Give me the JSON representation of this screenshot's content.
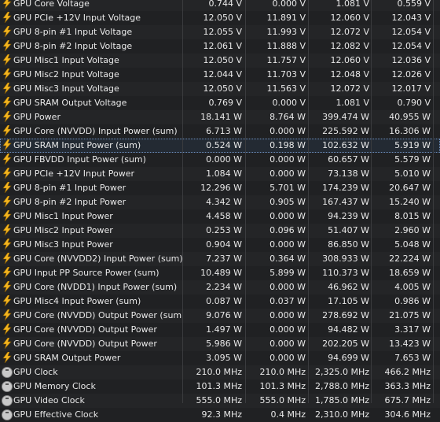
{
  "rows": [
    {
      "icon": "bolt-icon",
      "name": "GPU Core Voltage",
      "current": "0.744 V",
      "min": "0.000 V",
      "max": "1.081 V",
      "avg": "0.559 V"
    },
    {
      "icon": "bolt-icon",
      "name": "GPU PCIe +12V Input Voltage",
      "current": "12.050 V",
      "min": "11.891 V",
      "max": "12.060 V",
      "avg": "12.043 V"
    },
    {
      "icon": "bolt-icon",
      "name": "GPU 8-pin #1 Input Voltage",
      "current": "12.055 V",
      "min": "11.993 V",
      "max": "12.072 V",
      "avg": "12.054 V"
    },
    {
      "icon": "bolt-icon",
      "name": "GPU 8-pin #2 Input Voltage",
      "current": "12.061 V",
      "min": "11.888 V",
      "max": "12.082 V",
      "avg": "12.054 V"
    },
    {
      "icon": "bolt-icon",
      "name": "GPU Misc1 Input Voltage",
      "current": "12.050 V",
      "min": "11.757 V",
      "max": "12.060 V",
      "avg": "12.036 V"
    },
    {
      "icon": "bolt-icon",
      "name": "GPU Misc2 Input Voltage",
      "current": "12.044 V",
      "min": "11.703 V",
      "max": "12.048 V",
      "avg": "12.026 V"
    },
    {
      "icon": "bolt-icon",
      "name": "GPU Misc3 Input Voltage",
      "current": "12.050 V",
      "min": "11.563 V",
      "max": "12.072 V",
      "avg": "12.017 V"
    },
    {
      "icon": "bolt-icon",
      "name": "GPU SRAM Output Voltage",
      "current": "0.769 V",
      "min": "0.000 V",
      "max": "1.081 V",
      "avg": "0.790 V"
    },
    {
      "icon": "bolt-icon",
      "name": "GPU Power",
      "current": "18.141 W",
      "min": "8.764 W",
      "max": "399.474 W",
      "avg": "40.955 W"
    },
    {
      "icon": "bolt-icon",
      "name": "GPU Core (NVVDD) Input Power (sum)",
      "current": "6.713 W",
      "min": "0.000 W",
      "max": "225.592 W",
      "avg": "16.306 W"
    },
    {
      "icon": "bolt-icon",
      "name": "GPU SRAM Input Power (sum)",
      "current": "0.524 W",
      "min": "0.198 W",
      "max": "102.632 W",
      "avg": "5.919 W",
      "selected": true
    },
    {
      "icon": "bolt-icon",
      "name": "GPU FBVDD Input Power (sum)",
      "current": "0.000 W",
      "min": "0.000 W",
      "max": "60.657 W",
      "avg": "5.579 W"
    },
    {
      "icon": "bolt-icon",
      "name": "GPU PCIe +12V Input Power",
      "current": "1.084 W",
      "min": "0.000 W",
      "max": "73.138 W",
      "avg": "5.010 W"
    },
    {
      "icon": "bolt-icon",
      "name": "GPU 8-pin #1 Input Power",
      "current": "12.296 W",
      "min": "5.701 W",
      "max": "174.239 W",
      "avg": "20.647 W"
    },
    {
      "icon": "bolt-icon",
      "name": "GPU 8-pin #2 Input Power",
      "current": "4.342 W",
      "min": "0.905 W",
      "max": "167.437 W",
      "avg": "15.240 W"
    },
    {
      "icon": "bolt-icon",
      "name": "GPU Misc1 Input Power",
      "current": "4.458 W",
      "min": "0.000 W",
      "max": "94.239 W",
      "avg": "8.015 W"
    },
    {
      "icon": "bolt-icon",
      "name": "GPU Misc2 Input Power",
      "current": "0.253 W",
      "min": "0.096 W",
      "max": "51.407 W",
      "avg": "2.960 W"
    },
    {
      "icon": "bolt-icon",
      "name": "GPU Misc3 Input Power",
      "current": "0.904 W",
      "min": "0.000 W",
      "max": "86.850 W",
      "avg": "5.048 W"
    },
    {
      "icon": "bolt-icon",
      "name": "GPU Core (NVVDD2) Input Power (sum)",
      "current": "7.237 W",
      "min": "0.364 W",
      "max": "308.933 W",
      "avg": "22.224 W"
    },
    {
      "icon": "bolt-icon",
      "name": "GPU Input PP Source Power (sum)",
      "current": "10.489 W",
      "min": "5.899 W",
      "max": "110.373 W",
      "avg": "18.659 W"
    },
    {
      "icon": "bolt-icon",
      "name": "GPU Core (NVDD1) Input Power (sum)",
      "current": "2.234 W",
      "min": "0.000 W",
      "max": "46.962 W",
      "avg": "4.005 W"
    },
    {
      "icon": "bolt-icon",
      "name": "GPU Misc4 Input Power (sum)",
      "current": "0.087 W",
      "min": "0.037 W",
      "max": "17.105 W",
      "avg": "0.986 W"
    },
    {
      "icon": "bolt-icon",
      "name": "GPU Core (NVVDD) Output Power (sum)",
      "current": "9.076 W",
      "min": "0.000 W",
      "max": "278.692 W",
      "avg": "21.075 W"
    },
    {
      "icon": "bolt-icon",
      "name": "GPU Core (NVVDD) Output Power",
      "current": "1.497 W",
      "min": "0.000 W",
      "max": "94.482 W",
      "avg": "3.317 W"
    },
    {
      "icon": "bolt-icon",
      "name": "GPU Core (NVVDD) Output Power",
      "current": "5.986 W",
      "min": "0.000 W",
      "max": "202.205 W",
      "avg": "13.423 W"
    },
    {
      "icon": "bolt-icon",
      "name": "GPU SRAM Output Power",
      "current": "3.095 W",
      "min": "0.000 W",
      "max": "94.699 W",
      "avg": "7.653 W"
    },
    {
      "icon": "clock-icon",
      "name": "GPU Clock",
      "current": "210.0 MHz",
      "min": "210.0 MHz",
      "max": "2,325.0 MHz",
      "avg": "466.2 MHz"
    },
    {
      "icon": "clock-icon",
      "name": "GPU Memory Clock",
      "current": "101.3 MHz",
      "min": "101.3 MHz",
      "max": "2,788.0 MHz",
      "avg": "363.3 MHz"
    },
    {
      "icon": "clock-icon",
      "name": "GPU Video Clock",
      "current": "555.0 MHz",
      "min": "555.0 MHz",
      "max": "1,785.0 MHz",
      "avg": "675.7 MHz"
    },
    {
      "icon": "clock-icon",
      "name": "GPU Effective Clock",
      "current": "92.3 MHz",
      "min": "0.4 MHz",
      "max": "2,310.0 MHz",
      "avg": "304.6 MHz"
    }
  ],
  "colors": {
    "bolt": "#f3b51f",
    "clock": "#c9c9c9",
    "selection_outline": "#6e90c0"
  }
}
